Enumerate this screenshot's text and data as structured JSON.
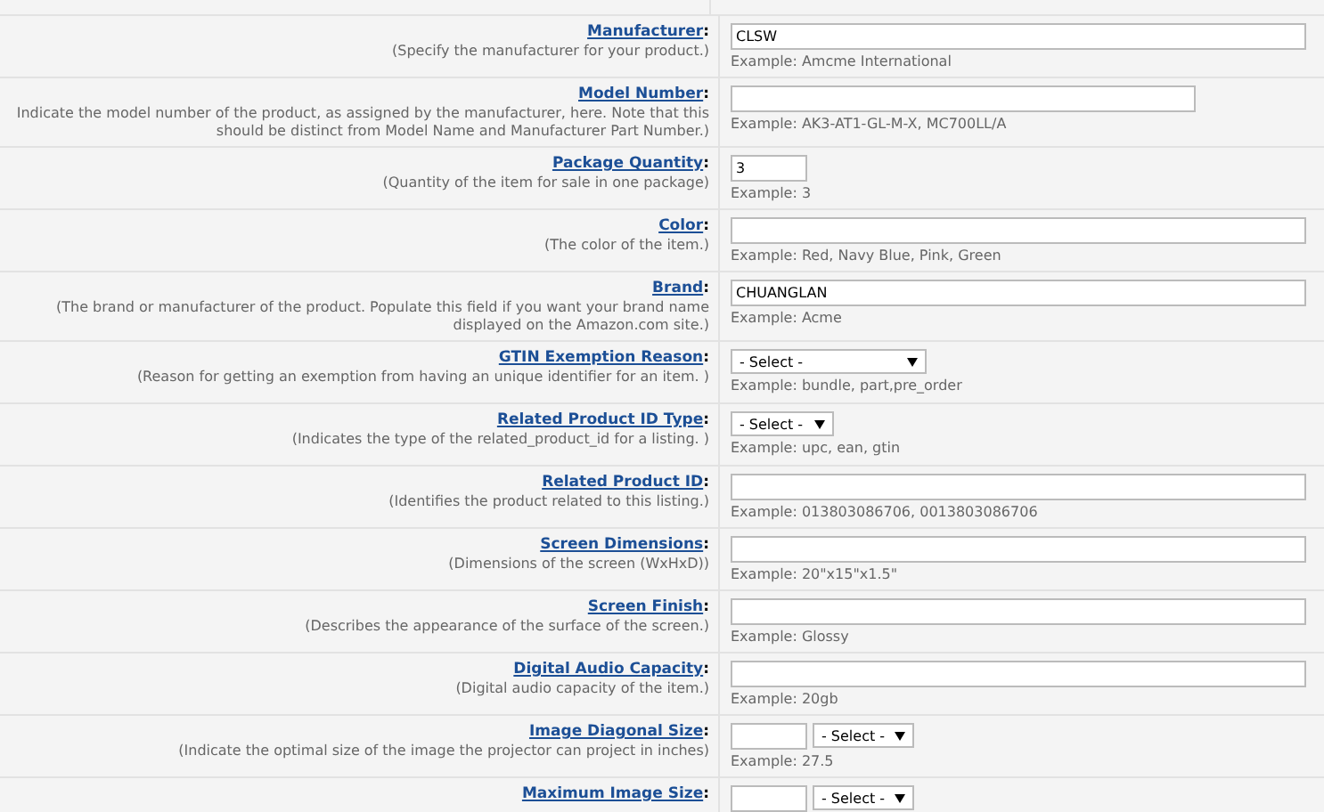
{
  "fields": [
    {
      "label": "Manufacturer",
      "colon": ":",
      "help": "(Specify the manufacturer for your product.)",
      "kind": "wide",
      "value": "CLSW",
      "example": "Example: Amcme International"
    },
    {
      "label": "Model Number",
      "colon": ":",
      "help": "Indicate the model number of the product, as assigned by the manufacturer, here. Note that this should be distinct from Model Name and Manufacturer Part Number.)",
      "kind": "medium",
      "example": "Example: AK3-AT1-GL-M-X, MC700LL/A"
    },
    {
      "label": "Package Quantity",
      "colon": ":",
      "help": "(Quantity of the item for sale in one package)",
      "kind": "short",
      "value": "3",
      "example": "Example: 3"
    },
    {
      "label": "Color",
      "colon": ":",
      "help": "(The color of the item.)",
      "kind": "wide",
      "example": "Example: Red, Navy Blue, Pink, Green"
    },
    {
      "label": "Brand",
      "colon": ":",
      "help": "(The brand or manufacturer of the product. Populate this field if you want your brand name displayed on the Amazon.com site.)",
      "kind": "wide",
      "value": "CHUANGLAN",
      "example": "Example: Acme"
    },
    {
      "label": "GTIN Exemption Reason",
      "colon": ":",
      "help": "(Reason for getting an exemption from having an unique identifier for an item. )",
      "kind": "select-wide",
      "select": "- Select -",
      "example": "Example: bundle, part,pre_order"
    },
    {
      "label": "Related Product ID Type",
      "colon": ":",
      "help": "(Indicates the type of the related_product_id for a listing. )",
      "kind": "select",
      "select": "- Select -",
      "example": "Example: upc, ean, gtin"
    },
    {
      "label": "Related Product ID",
      "colon": ":",
      "help": "(Identifies the product related to this listing.)",
      "kind": "wide",
      "example": "Example: 013803086706, 0013803086706"
    },
    {
      "label": "Screen Dimensions",
      "colon": ":",
      "help": "(Dimensions of the screen (WxHxD))",
      "kind": "wide",
      "example": "Example: 20\"x15\"x1.5\""
    },
    {
      "label": "Screen Finish",
      "colon": ":",
      "help": "(Describes the appearance of the surface of the screen.)",
      "kind": "wide",
      "example": "Example: Glossy"
    },
    {
      "label": "Digital Audio Capacity",
      "colon": ":",
      "help": "(Digital audio capacity of the item.)",
      "kind": "wide",
      "example": "Example: 20gb"
    },
    {
      "label": "Image Diagonal Size",
      "colon": ":",
      "help": "(Indicate the optimal size of the image the projector can project in inches)",
      "kind": "unit",
      "select": "- Select -",
      "example": "Example: 27.5"
    },
    {
      "label": "Maximum Image Size",
      "colon": ":",
      "kind": "unit",
      "select": "- Select -"
    }
  ]
}
